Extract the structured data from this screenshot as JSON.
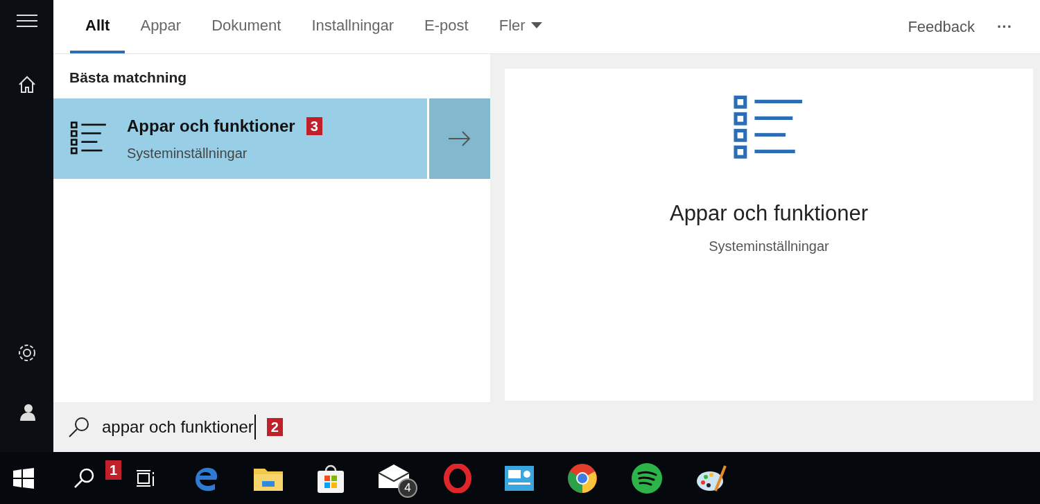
{
  "tabs": [
    {
      "label": "Allt",
      "selected": true,
      "kind": "plain"
    },
    {
      "label": "Appar",
      "selected": false,
      "kind": "plain"
    },
    {
      "label": "Dokument",
      "selected": false,
      "kind": "plain"
    },
    {
      "label": "Installningar",
      "selected": false,
      "kind": "plain"
    },
    {
      "label": "E-post",
      "selected": false,
      "kind": "plain"
    },
    {
      "label": "Fler",
      "selected": false,
      "kind": "dropdown"
    }
  ],
  "feedback": "Feedback",
  "more": "···",
  "section_title": "Bästa matchning",
  "best_match": {
    "title": "Appar och funktioner",
    "subtitle": "Systeminställningar",
    "callout": "3",
    "selected": true
  },
  "preview": {
    "title": "Appar och funktioner",
    "subtitle": "Systeminställningar"
  },
  "search": {
    "value": "appar och funktioner",
    "callout": "2"
  },
  "taskbar": {
    "search_callout": "1",
    "mail_badge": "4"
  }
}
